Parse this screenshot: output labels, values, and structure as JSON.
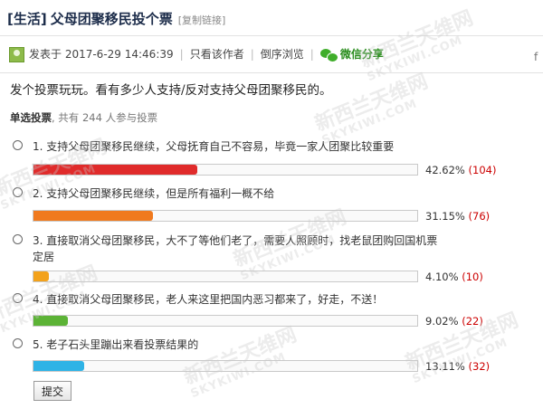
{
  "thread": {
    "category": "[生活]",
    "title": "父母团聚移民投个票",
    "copy_link": "[复制链接]"
  },
  "meta": {
    "posted_at": "发表于 2017-6-29 14:46:39",
    "only_author": "只看该作者",
    "reverse_view": "倒序浏览",
    "wechat_share": "微信分享",
    "separator": "|"
  },
  "post_text": "发个投票玩玩。看有多少人支持/反对支持父母团聚移民的。",
  "poll": {
    "type_label": "单选投票",
    "participants": ", 共有 244 人参与投票",
    "options": [
      {
        "label": "1.  支持父母团聚移民继续，父母抚育自己不容易，毕竟一家人团聚比较重要",
        "percent_text": "42.62%",
        "count_text": "(104)",
        "fraction": 0.4262,
        "color": "#e02b2b"
      },
      {
        "label": "2.  支持父母团聚移民继续，但是所有福利一概不给",
        "percent_text": "31.15%",
        "count_text": "(76)",
        "fraction": 0.3115,
        "color": "#f07a1e"
      },
      {
        "label": "3.  直接取消父母团聚移民，大不了等他们老了，需要人照顾时，找老鼠团购回国机票定居",
        "percent_text": "4.10%",
        "count_text": "(10)",
        "fraction": 0.041,
        "color": "#f3a21c"
      },
      {
        "label": "4.  直接取消父母团聚移民，老人来这里把国内恶习都来了，好走，不送！",
        "percent_text": "9.02%",
        "count_text": "(22)",
        "fraction": 0.0902,
        "color": "#5cb336"
      },
      {
        "label": "5.  老子石头里蹦出来看投票结果的",
        "percent_text": "13.11%",
        "count_text": "(32)",
        "fraction": 0.1311,
        "color": "#2fb3e6"
      }
    ],
    "submit_label": "提交"
  },
  "watermark": {
    "brand": "新西兰天维网",
    "site": "SKYKIWI.COM"
  },
  "scroll_glyph": "f"
}
